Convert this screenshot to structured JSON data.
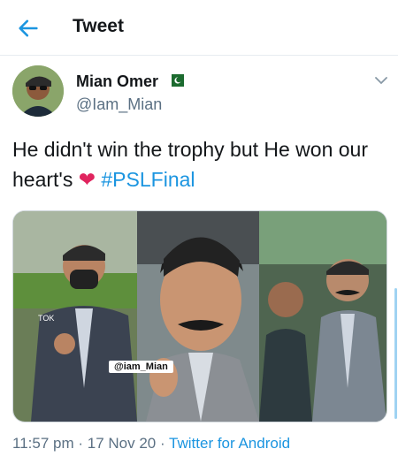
{
  "header": {
    "title": "Tweet",
    "back_icon": "back-arrow-icon"
  },
  "tweet": {
    "author_name": "Mian Omer",
    "author_handle": "@Iam_Mian",
    "flag_icon": "pakistan-flag-icon",
    "text_main": "He didn't win the trophy but He won our heart's ",
    "heart": "❤",
    "hashtag": "#PSLFinal",
    "media_watermark": "@iam_Mian",
    "time": "11:57 pm",
    "dot": " · ",
    "date": "17 Nov 20",
    "app": "Twitter for Android"
  },
  "colors": {
    "accent": "#1b95e0",
    "heart": "#e0245e",
    "muted": "#5b7083"
  }
}
